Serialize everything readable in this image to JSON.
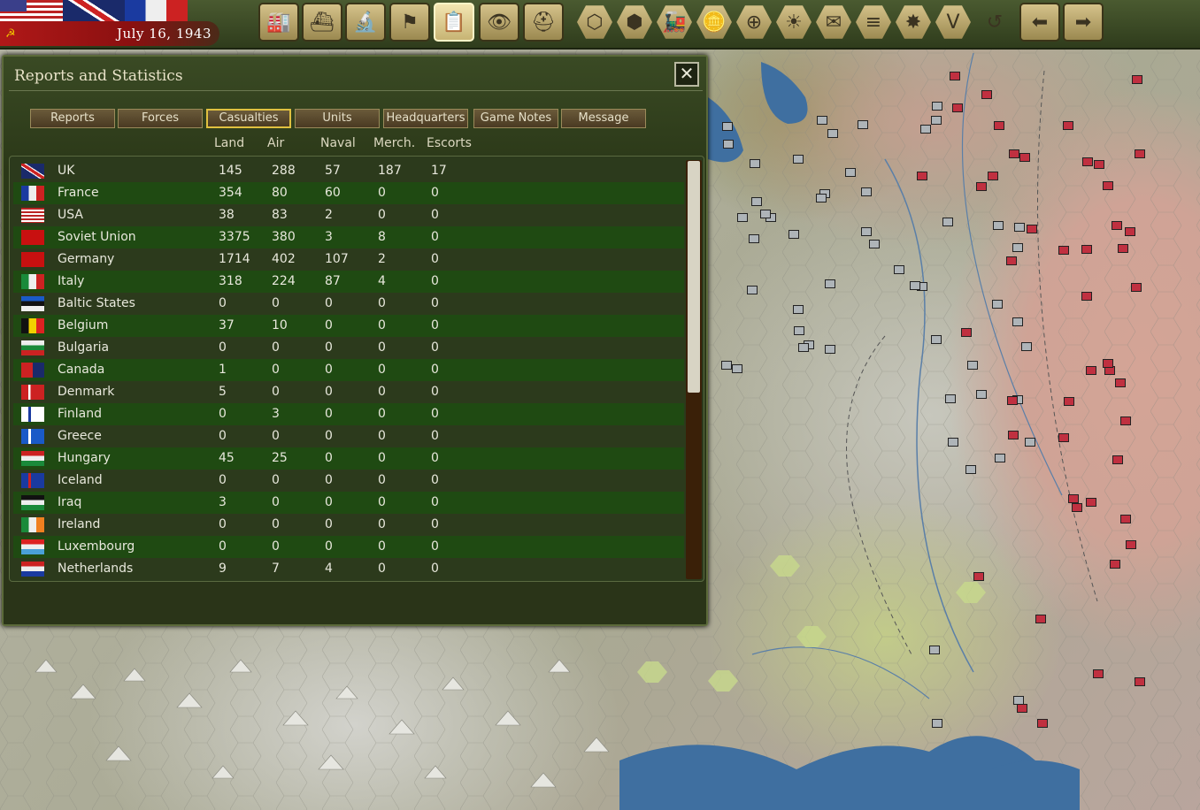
{
  "header": {
    "date": "July 16, 1943"
  },
  "toolbar": {
    "buttons": [
      {
        "name": "production-button",
        "icon": "factory-icon",
        "glyph": "🏭"
      },
      {
        "name": "research-button",
        "icon": "ship-icon",
        "glyph": "⛴"
      },
      {
        "name": "lab-button",
        "icon": "microscope-icon",
        "glyph": "🔬"
      },
      {
        "name": "diplomacy-button",
        "icon": "flag-icon",
        "glyph": "⚑"
      },
      {
        "name": "reports-button",
        "icon": "report-icon",
        "glyph": "📋"
      },
      {
        "name": "intel-button",
        "icon": "binoculars-icon",
        "glyph": "👁"
      },
      {
        "name": "units-button",
        "icon": "helmet-icon",
        "glyph": "⛑"
      }
    ],
    "hex_buttons": [
      {
        "name": "hex-grid-button",
        "icon": "hex-icon",
        "glyph": "⬡"
      },
      {
        "name": "supply-button",
        "icon": "hexes-icon",
        "glyph": "⬢"
      },
      {
        "name": "rail-button",
        "icon": "train-icon",
        "glyph": "🚂"
      },
      {
        "name": "resources-button",
        "icon": "coins-icon",
        "glyph": "🪙"
      },
      {
        "name": "target-button",
        "icon": "crosshair-icon",
        "glyph": "⊕"
      },
      {
        "name": "weather-button",
        "icon": "sun-icon",
        "glyph": "☀"
      },
      {
        "name": "mail-button",
        "icon": "envelope-icon",
        "glyph": "✉"
      },
      {
        "name": "road-button",
        "icon": "road-icon",
        "glyph": "≡"
      },
      {
        "name": "combat-button",
        "icon": "explosion-icon",
        "glyph": "✸"
      },
      {
        "name": "victory-button",
        "icon": "victory-icon",
        "glyph": "V"
      }
    ],
    "undo": {
      "icon": "undo-icon",
      "glyph": "↺"
    },
    "prev": {
      "icon": "arrow-left-icon",
      "glyph": "⬅"
    },
    "next": {
      "icon": "arrow-right-icon",
      "glyph": "➡"
    }
  },
  "panel": {
    "title": "Reports and Statistics",
    "close": "✕",
    "tabs": [
      "Reports",
      "Forces",
      "Casualties",
      "Units",
      "Headquarters",
      "Game Notes",
      "Message"
    ],
    "active_tab": "Casualties",
    "columns": [
      "Land",
      "Air",
      "Naval",
      "Merch.",
      "Escorts"
    ],
    "rows": [
      {
        "country": "UK",
        "values": [
          "145",
          "288",
          "57",
          "187",
          "17"
        ]
      },
      {
        "country": "France",
        "values": [
          "354",
          "80",
          "60",
          "0",
          "0"
        ]
      },
      {
        "country": "USA",
        "values": [
          "38",
          "83",
          "2",
          "0",
          "0"
        ]
      },
      {
        "country": "Soviet Union",
        "values": [
          "3375",
          "380",
          "3",
          "8",
          "0"
        ]
      },
      {
        "country": "Germany",
        "values": [
          "1714",
          "402",
          "107",
          "2",
          "0"
        ]
      },
      {
        "country": "Italy",
        "values": [
          "318",
          "224",
          "87",
          "4",
          "0"
        ]
      },
      {
        "country": "Baltic States",
        "values": [
          "0",
          "0",
          "0",
          "0",
          "0"
        ]
      },
      {
        "country": "Belgium",
        "values": [
          "37",
          "10",
          "0",
          "0",
          "0"
        ]
      },
      {
        "country": "Bulgaria",
        "values": [
          "0",
          "0",
          "0",
          "0",
          "0"
        ]
      },
      {
        "country": "Canada",
        "values": [
          "1",
          "0",
          "0",
          "0",
          "0"
        ]
      },
      {
        "country": "Denmark",
        "values": [
          "5",
          "0",
          "0",
          "0",
          "0"
        ]
      },
      {
        "country": "Finland",
        "values": [
          "0",
          "3",
          "0",
          "0",
          "0"
        ]
      },
      {
        "country": "Greece",
        "values": [
          "0",
          "0",
          "0",
          "0",
          "0"
        ]
      },
      {
        "country": "Hungary",
        "values": [
          "45",
          "25",
          "0",
          "0",
          "0"
        ]
      },
      {
        "country": "Iceland",
        "values": [
          "0",
          "0",
          "0",
          "0",
          "0"
        ]
      },
      {
        "country": "Iraq",
        "values": [
          "3",
          "0",
          "0",
          "0",
          "0"
        ]
      },
      {
        "country": "Ireland",
        "values": [
          "0",
          "0",
          "0",
          "0",
          "0"
        ]
      },
      {
        "country": "Luxembourg",
        "values": [
          "0",
          "0",
          "0",
          "0",
          "0"
        ]
      },
      {
        "country": "Netherlands",
        "values": [
          "9",
          "7",
          "4",
          "0",
          "0"
        ]
      }
    ]
  }
}
